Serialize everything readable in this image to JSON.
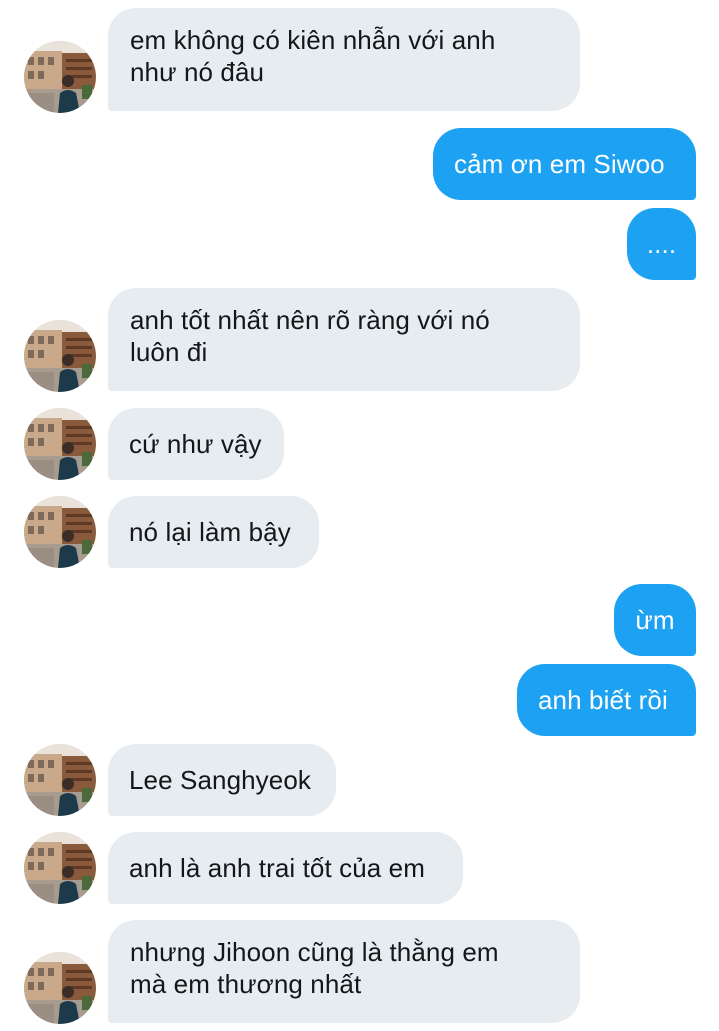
{
  "conversation": {
    "messages": [
      {
        "direction": "in",
        "text": "em không có kiên nhẫn với anh\nnhư nó đâu",
        "avatar": "profile-photo"
      },
      {
        "direction": "out",
        "text": "cảm ơn em Siwoo"
      },
      {
        "direction": "out",
        "text": "...."
      },
      {
        "direction": "in",
        "text": "anh tốt nhất nên rõ ràng với nó\nluôn đi",
        "avatar": "profile-photo"
      },
      {
        "direction": "in",
        "text": "cứ như vậy",
        "avatar": "profile-photo"
      },
      {
        "direction": "in",
        "text": "nó lại làm bậy",
        "avatar": "profile-photo"
      },
      {
        "direction": "out",
        "text": "ừm"
      },
      {
        "direction": "out",
        "text": "anh biết rồi"
      },
      {
        "direction": "in",
        "text": "Lee Sanghyeok",
        "avatar": "profile-photo"
      },
      {
        "direction": "in",
        "text": "anh là anh trai tốt của em",
        "avatar": "profile-photo"
      },
      {
        "direction": "in",
        "text": "nhưng Jihoon cũng là thằng em\nmà em thương nhất",
        "avatar": "profile-photo"
      }
    ]
  },
  "colors": {
    "incoming_bubble": "#e6ecf0",
    "outgoing_bubble": "#1da1f2",
    "incoming_text": "#14171a",
    "outgoing_text": "#ffffff"
  }
}
